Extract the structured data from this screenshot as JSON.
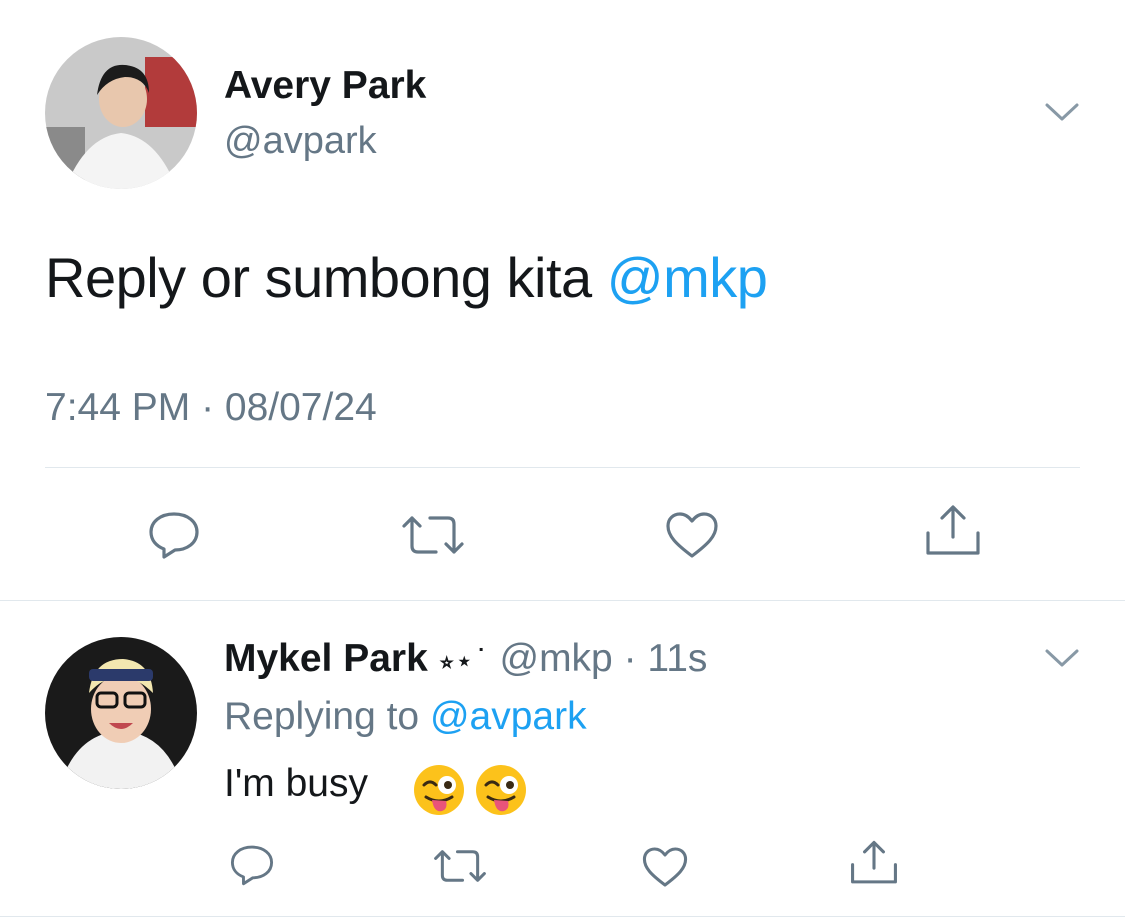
{
  "main_tweet": {
    "display_name": "Avery Park",
    "handle": "@avpark",
    "text": "Reply or sumbong kita ",
    "mention": "@mkp",
    "timestamp": "7:44 PM · 08/07/24"
  },
  "reply_tweet": {
    "display_name": "Mykel Park",
    "name_decoration": "⭒⋆˙",
    "handle": "@mkp",
    "time": "· 11s",
    "replying_label": "Replying to ",
    "replying_to": "@avpark",
    "text": "I'm busy",
    "emojis": [
      "winking-face-with-tongue",
      "winking-face-with-tongue"
    ]
  },
  "colors": {
    "accent": "#1da1f2",
    "secondary_text": "#657786",
    "divider": "#e1e8ed"
  },
  "icons": [
    "reply-icon",
    "retweet-icon",
    "like-icon",
    "share-icon",
    "chevron-down-icon"
  ]
}
